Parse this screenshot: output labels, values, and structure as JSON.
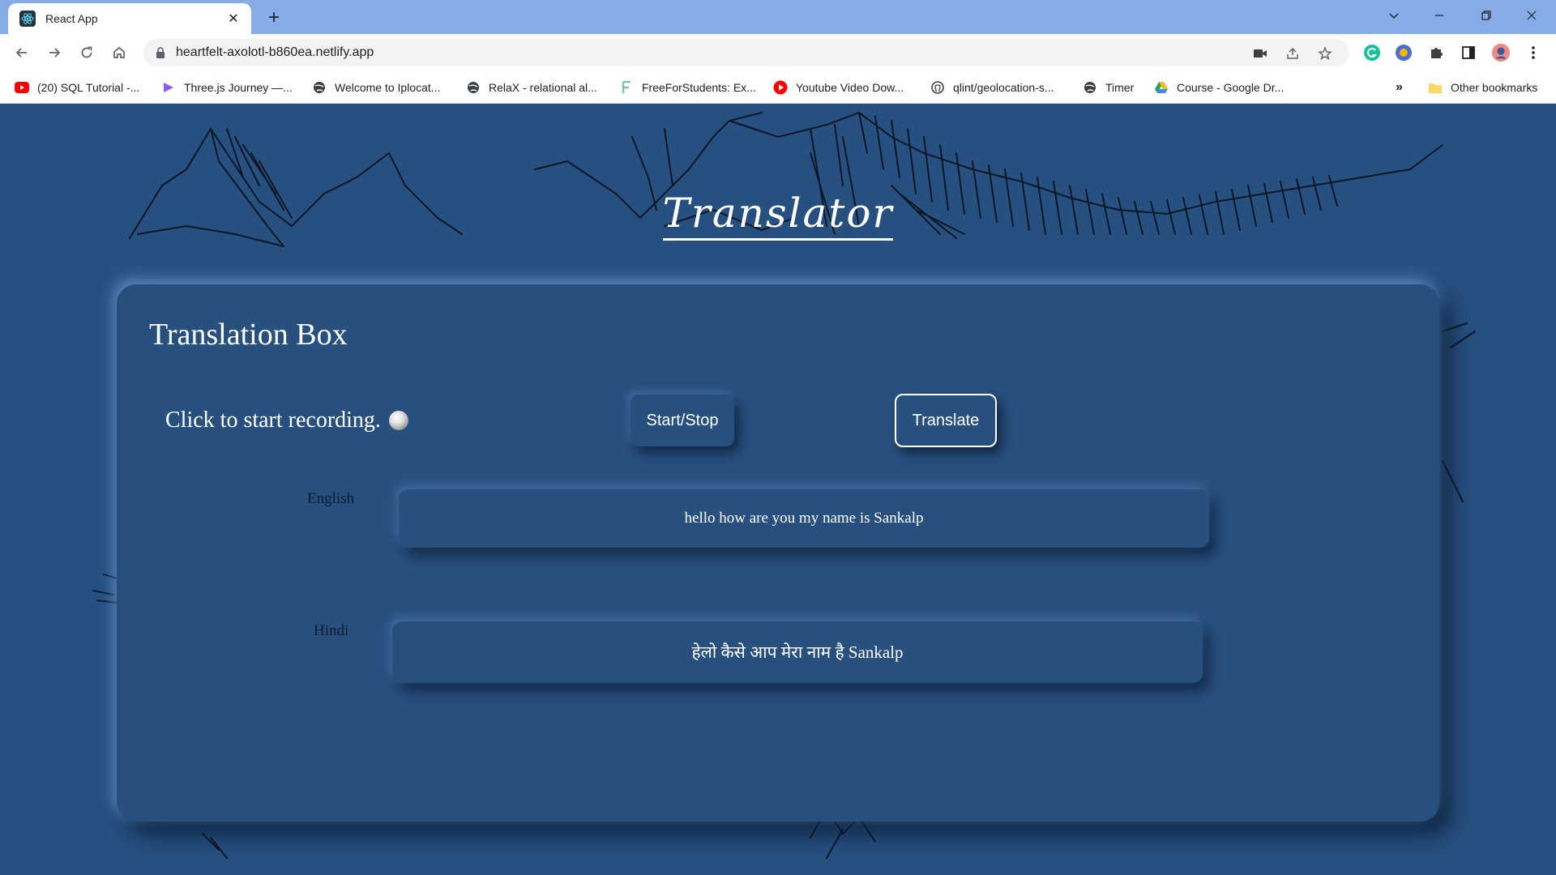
{
  "browser": {
    "tab_title": "React App",
    "tab_close": "✕",
    "new_tab": "+",
    "url": "heartfelt-axolotl-b860ea.netlify.app",
    "window_controls": {
      "minimize": "—",
      "restore": "❐",
      "close": "✕",
      "tab_search": "⌄"
    },
    "bookmarks": [
      {
        "label": "(20) SQL Tutorial -...",
        "icon": "youtube-icon",
        "color": "#ff0000"
      },
      {
        "label": "Three.js Journey —...",
        "icon": "threejs-icon",
        "color": "#8b5cf6"
      },
      {
        "label": "Welcome to Iplocat...",
        "icon": "globe-icon",
        "color": "#3c4043"
      },
      {
        "label": "RelaX - relational al...",
        "icon": "globe-icon",
        "color": "#3c4043"
      },
      {
        "label": "FreeForStudents: Ex...",
        "icon": "f-icon",
        "color": "#7ac2a4"
      },
      {
        "label": "Youtube Video Dow...",
        "icon": "play-icon",
        "color": "#ff0000"
      },
      {
        "label": "qlint/geolocation-s...",
        "icon": "github-icon",
        "color": "#3c4043"
      },
      {
        "label": "Timer",
        "icon": "globe-icon",
        "color": "#3c4043"
      },
      {
        "label": "Course - Google Dr...",
        "icon": "drive-icon",
        "color": "#fbbc04"
      }
    ],
    "bookmarks_more": "»",
    "other_bookmarks": "Other bookmarks"
  },
  "app": {
    "title": "Translator",
    "box_title": "Translation Box",
    "record_prompt": "Click to start recording.",
    "start_stop_label": "Start/Stop",
    "translate_label": "Translate",
    "source_language": "English",
    "source_text": "hello how are you my name is Sankalp",
    "target_language": "Hindi",
    "target_text": "हेलो कैसे आप मेरा नाम है Sankalp"
  },
  "colors": {
    "page_bg": "#26507f",
    "tab_strip": "#86ace8",
    "text_white": "#ffffff",
    "label_dark": "#0d1b2e"
  }
}
